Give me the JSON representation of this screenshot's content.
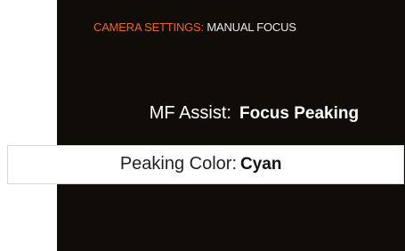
{
  "header": {
    "category": "CAMERA SETTINGS:",
    "page": "MANUAL FOCUS"
  },
  "settings": [
    {
      "label": "MF Assist:",
      "value": "Focus Peaking"
    },
    {
      "label": "Peaking Color:",
      "value": "Cyan"
    }
  ],
  "colors": {
    "screen_background": "#100c08",
    "category_accent": "#e06a2c",
    "text_primary": "#ffffff",
    "selected_row_background": "#ffffff",
    "selected_row_text": "#222222"
  }
}
